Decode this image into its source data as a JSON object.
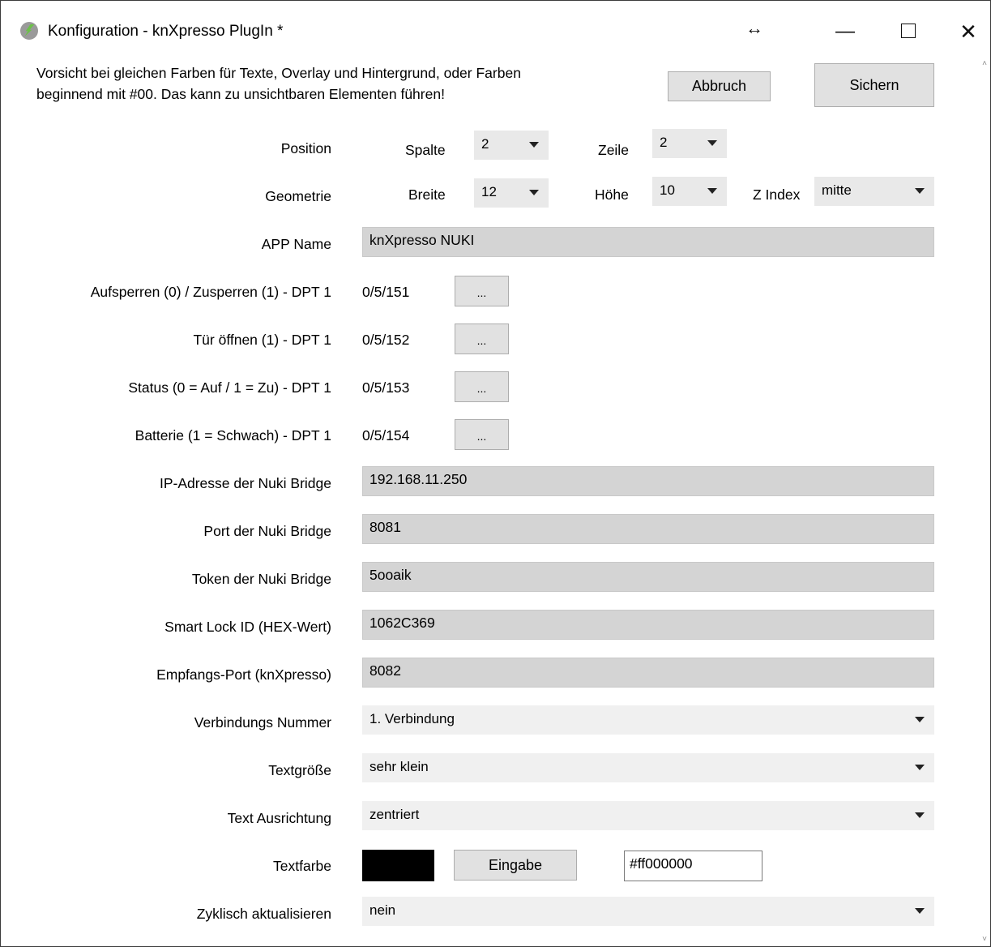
{
  "window": {
    "title": "Konfiguration - knXpresso PlugIn *",
    "icons": {
      "app": "knxpresso-logo-icon",
      "resize": "horizontal-resize-icon",
      "minimize": "minimize-icon",
      "maximize": "maximize-icon",
      "close": "close-icon"
    },
    "resize_glyph": "↔",
    "minimize_glyph": "—",
    "close_glyph": "✕"
  },
  "header": {
    "warning_line1": "Vorsicht bei gleichen Farben für Texte, Overlay und Hintergrund, oder Farben",
    "warning_line2": "beginnend mit #00. Das kann zu unsichtbaren Elementen führen!",
    "cancel_label": "Abbruch",
    "save_label": "Sichern"
  },
  "position": {
    "label": "Position",
    "column_label": "Spalte",
    "column_value": "2",
    "row_label": "Zeile",
    "row_value": "2"
  },
  "geometry": {
    "label": "Geometrie",
    "width_label": "Breite",
    "width_value": "12",
    "height_label": "Höhe",
    "height_value": "10",
    "zindex_label": "Z Index",
    "zindex_value": "mitte"
  },
  "app_name": {
    "label": "APP Name",
    "value": "knXpresso NUKI"
  },
  "group_addresses": [
    {
      "label": "Aufsperren (0) / Zusperren (1) - DPT 1",
      "address": "0/5/151",
      "button": "..."
    },
    {
      "label": "Tür öffnen (1) - DPT 1",
      "address": "0/5/152",
      "button": "..."
    },
    {
      "label": "Status (0 = Auf / 1 = Zu) - DPT 1",
      "address": "0/5/153",
      "button": "..."
    },
    {
      "label": "Batterie (1 = Schwach) - DPT 1",
      "address": "0/5/154",
      "button": "..."
    }
  ],
  "fields": [
    {
      "label": "IP-Adresse der Nuki Bridge",
      "value": "192.168.11.250"
    },
    {
      "label": "Port der Nuki Bridge",
      "value": "8081"
    },
    {
      "label": "Token der Nuki Bridge",
      "value": "5ooaik"
    },
    {
      "label": "Smart Lock ID (HEX-Wert)",
      "value": "1062C369"
    },
    {
      "label": "Empfangs-Port (knXpresso)",
      "value": "8082"
    }
  ],
  "dropdowns": [
    {
      "label": "Verbindungs Nummer",
      "value": "1. Verbindung"
    },
    {
      "label": "Textgröße",
      "value": "sehr klein"
    },
    {
      "label": "Text Ausrichtung",
      "value": "zentriert"
    }
  ],
  "text_color": {
    "label": "Textfarbe",
    "swatch_color": "#000000",
    "button_label": "Eingabe",
    "hex_value": "#ff000000"
  },
  "cyclic_update": {
    "label": "Zyklisch aktualisieren",
    "value": "nein"
  },
  "scrollbar": {
    "icons": [
      "chevron-up-icon",
      "chevron-down-icon"
    ]
  }
}
